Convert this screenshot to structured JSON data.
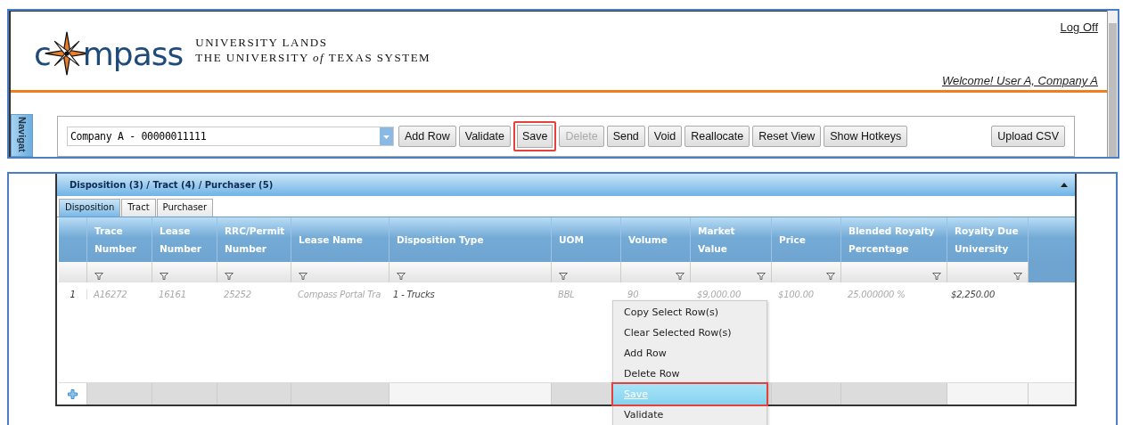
{
  "header": {
    "logo": {
      "left": "c",
      "right": "mpass"
    },
    "org_line_1": "UNIVERSITY LANDS",
    "org_line_2": "THE UNIVERSITY *of* TEXAS SYSTEM",
    "log_off": "Log Off",
    "welcome": "Welcome! User A, Company A"
  },
  "navigation_tab": "Navigat",
  "toolbar": {
    "company_select": {
      "value": "Company A - 00000011111"
    },
    "buttons": [
      {
        "label": "Add Row",
        "disabled": false,
        "highlighted": false
      },
      {
        "label": "Validate",
        "disabled": false,
        "highlighted": false
      },
      {
        "label": "Save",
        "disabled": false,
        "highlighted": true
      },
      {
        "label": "Delete",
        "disabled": true,
        "highlighted": false
      },
      {
        "label": "Send",
        "disabled": false,
        "highlighted": false
      },
      {
        "label": "Void",
        "disabled": false,
        "highlighted": false
      },
      {
        "label": "Reallocate",
        "disabled": false,
        "highlighted": false
      },
      {
        "label": "Reset View",
        "disabled": false,
        "highlighted": false
      },
      {
        "label": "Show Hotkeys",
        "disabled": false,
        "highlighted": false
      }
    ],
    "upload_button": "Upload CSV"
  },
  "grid_panel": {
    "title": "Disposition (3) / Tract (4) / Purchaser (5)",
    "expanded": true,
    "tabs": [
      {
        "label": "Disposition",
        "selected": true
      },
      {
        "label": "Tract",
        "selected": false
      },
      {
        "label": "Purchaser",
        "selected": false
      }
    ],
    "columns": [
      {
        "label": "Trace Number",
        "editable": false
      },
      {
        "label": "Lease Number",
        "editable": false
      },
      {
        "label": "RRC/Permit Number",
        "editable": false
      },
      {
        "label": "Lease Name",
        "editable": false
      },
      {
        "label": "Disposition Type",
        "editable": true
      },
      {
        "label": "UOM",
        "editable": false
      },
      {
        "label": "Volume",
        "editable": false
      },
      {
        "label": "Market Value",
        "editable": false
      },
      {
        "label": "Price",
        "editable": false
      },
      {
        "label": "Blended Royalty Percentage",
        "editable": false
      },
      {
        "label": "Royalty Due University",
        "editable": true
      }
    ],
    "rows": [
      {
        "number": "1",
        "cells": [
          "A16272",
          "16161",
          "25252",
          "Compass Portal Tra",
          "1 - Trucks",
          "BBL",
          "90",
          "$9,000.00",
          "$100.00",
          "25.000000 %",
          "$2,250.00"
        ]
      }
    ]
  },
  "context_menu": [
    {
      "label": "Copy Select Row(s)",
      "selected": false
    },
    {
      "label": "Clear Selected Row(s)",
      "selected": false
    },
    {
      "label": "Add Row",
      "selected": false
    },
    {
      "label": "Delete Row",
      "selected": false
    },
    {
      "label": "Save",
      "selected": true
    },
    {
      "label": "Validate",
      "selected": false
    }
  ]
}
